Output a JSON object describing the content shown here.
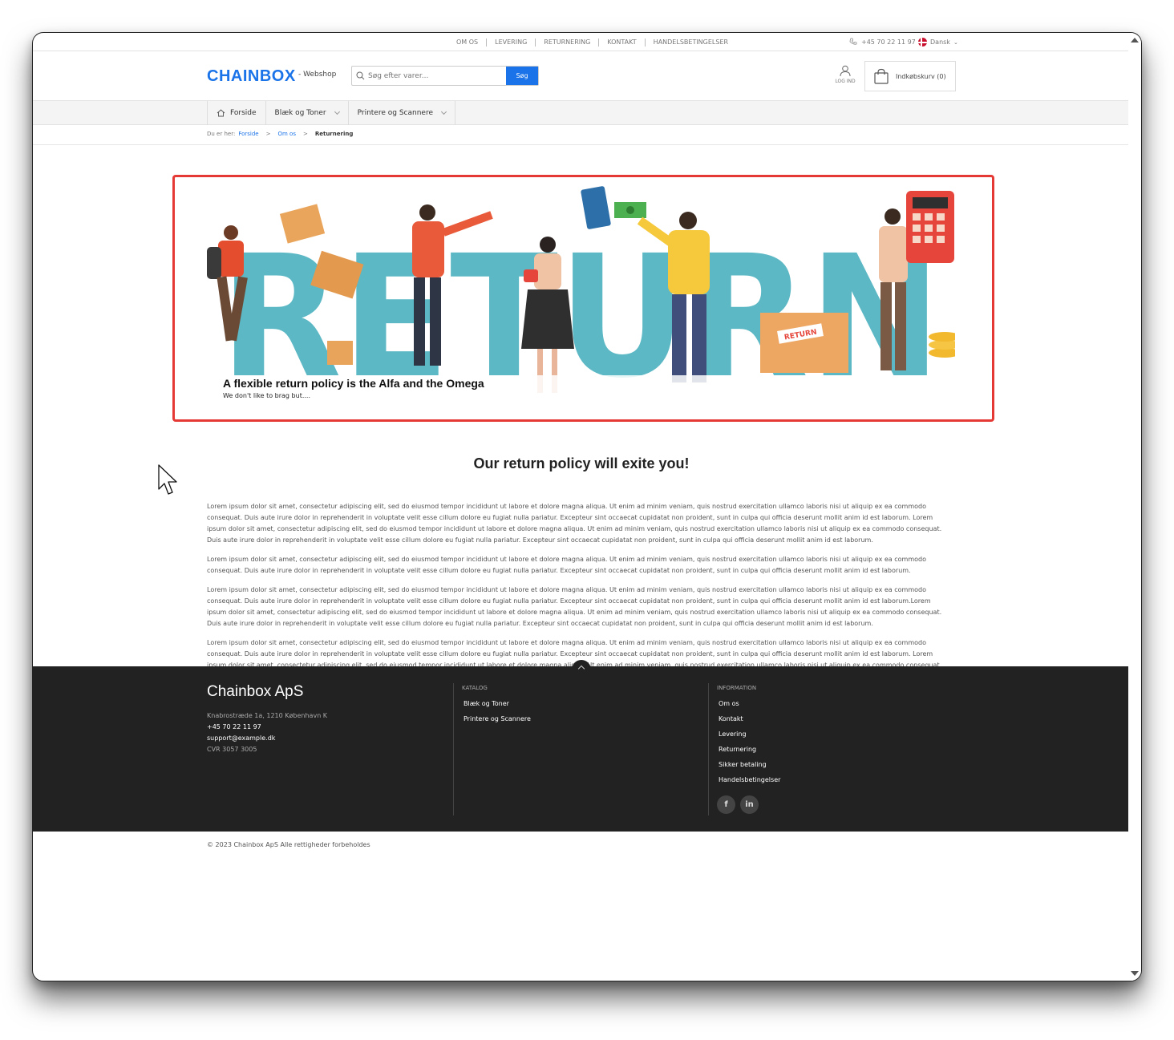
{
  "topbar": {
    "links": [
      "OM OS",
      "LEVERING",
      "RETURNERING",
      "KONTAKT",
      "HANDELSBETINGELSER"
    ],
    "phone": "+45 70 22 11 97",
    "language": "Dansk"
  },
  "header": {
    "logo": "CHAINBOX",
    "subtitle": "- Webshop",
    "search_placeholder": "Søg efter varer...",
    "search_button": "Søg",
    "login_label": "LOG IND",
    "cart_label": "Indkøbskurv (0)"
  },
  "nav": {
    "items": [
      {
        "label": "Forside",
        "icon": "home-icon"
      },
      {
        "label": "Blæk og Toner",
        "icon": "chevron-down-icon"
      },
      {
        "label": "Printere og Scannere",
        "icon": "chevron-down-icon"
      }
    ]
  },
  "breadcrumb": {
    "prefix": "Du er her:",
    "items": [
      "Forside",
      "Om os"
    ],
    "current": "Returnering"
  },
  "hero": {
    "image_text": "RETURN",
    "box_label": "RETURN",
    "title": "A flexible return policy is the Alfa and the Omega",
    "subtitle": "We don't like to brag but...."
  },
  "content": {
    "title": "Our return policy will exite you!",
    "paragraphs": [
      "Lorem ipsum dolor sit amet, consectetur adipiscing elit, sed do eiusmod tempor incididunt ut labore et dolore magna aliqua. Ut enim ad minim veniam, quis nostrud exercitation ullamco laboris nisi ut aliquip ex ea commodo consequat. Duis aute irure dolor in reprehenderit in voluptate velit esse cillum dolore eu fugiat nulla pariatur. Excepteur sint occaecat cupidatat non proident, sunt in culpa qui officia deserunt mollit anim id est laborum. Lorem ipsum dolor sit amet, consectetur adipiscing elit, sed do eiusmod tempor incididunt ut labore et dolore magna aliqua. Ut enim ad minim veniam, quis nostrud exercitation ullamco laboris nisi ut aliquip ex ea commodo consequat. Duis aute irure dolor in reprehenderit in voluptate velit esse cillum dolore eu fugiat nulla pariatur. Excepteur sint occaecat cupidatat non proident, sunt in culpa qui officia deserunt mollit anim id est laborum.",
      "Lorem ipsum dolor sit amet, consectetur adipiscing elit, sed do eiusmod tempor incididunt ut labore et dolore magna aliqua. Ut enim ad minim veniam, quis nostrud exercitation ullamco laboris nisi ut aliquip ex ea commodo consequat. Duis aute irure dolor in reprehenderit in voluptate velit esse cillum dolore eu fugiat nulla pariatur. Excepteur sint occaecat cupidatat non proident, sunt in culpa qui officia deserunt mollit anim id est laborum.",
      "Lorem ipsum dolor sit amet, consectetur adipiscing elit, sed do eiusmod tempor incididunt ut labore et dolore magna aliqua. Ut enim ad minim veniam, quis nostrud exercitation ullamco laboris nisi ut aliquip ex ea commodo consequat. Duis aute irure dolor in reprehenderit in voluptate velit esse cillum dolore eu fugiat nulla pariatur. Excepteur sint occaecat cupidatat non proident, sunt in culpa qui officia deserunt mollit anim id est laborum.Lorem ipsum dolor sit amet, consectetur adipiscing elit, sed do eiusmod tempor incididunt ut labore et dolore magna aliqua. Ut enim ad minim veniam, quis nostrud exercitation ullamco laboris nisi ut aliquip ex ea commodo consequat. Duis aute irure dolor in reprehenderit in voluptate velit esse cillum dolore eu fugiat nulla pariatur. Excepteur sint occaecat cupidatat non proident, sunt in culpa qui officia deserunt mollit anim id est laborum.",
      "Lorem ipsum dolor sit amet, consectetur adipiscing elit, sed do eiusmod tempor incididunt ut labore et dolore magna aliqua. Ut enim ad minim veniam, quis nostrud exercitation ullamco laboris nisi ut aliquip ex ea commodo consequat. Duis aute irure dolor in reprehenderit in voluptate velit esse cillum dolore eu fugiat nulla pariatur. Excepteur sint occaecat cupidatat non proident, sunt in culpa qui officia deserunt mollit anim id est laborum. Lorem ipsum dolor sit amet, consectetur adipiscing elit, sed do eiusmod tempor incididunt ut labore et dolore magna aliqua. Ut enim ad minim veniam, quis nostrud exercitation ullamco laboris nisi ut aliquip ex ea commodo consequat. Duis aute irure dolor in reprehenderit in voluptate velit esse cillum dolore eu fugiat nulla pariatur. Excepteur sint occaecat cupidatat non proident, sunt in culpa qui officia deserunt mollit anim id e"
    ]
  },
  "footer": {
    "company": "Chainbox ApS",
    "address": "Knabrostræde 1a, 1210 København K",
    "phone": "+45 70 22 11 97",
    "email": "support@example.dk",
    "cvr": "CVR 3057 3005",
    "catalog": {
      "heading": "KATALOG",
      "links": [
        "Blæk og Toner",
        "Printere og Scannere"
      ]
    },
    "information": {
      "heading": "INFORMATION",
      "links": [
        "Om os",
        "Kontakt",
        "Levering",
        "Returnering",
        "Sikker betaling",
        "Handelsbetingelser"
      ]
    },
    "social": [
      "f",
      "in"
    ],
    "copyright": "© 2023 Chainbox ApS Alle rettigheder forbeholdes"
  },
  "colors": {
    "accent": "#1a73e8",
    "highlight": "#e53935",
    "footer_bg": "#222222",
    "hero_letters": "#5bb8c4"
  }
}
